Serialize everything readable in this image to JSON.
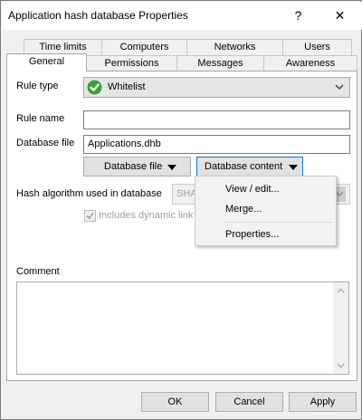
{
  "window": {
    "title": "Application hash database Properties",
    "help_glyph": "?",
    "close_glyph": "✕"
  },
  "tabs": {
    "row1": [
      "Time limits",
      "Computers",
      "Networks",
      "Users"
    ],
    "row2": [
      "General",
      "Permissions",
      "Messages",
      "Awareness"
    ],
    "active": "General"
  },
  "form": {
    "rule_type_label": "Rule type",
    "rule_type_value": "Whitelist",
    "rule_name_label": "Rule name",
    "rule_name_value": "",
    "database_file_label": "Database file",
    "database_file_value": "Applications.dhb",
    "database_file_button": "Database file",
    "database_content_button": "Database content",
    "hash_algorithm_label": "Hash algorithm used in database",
    "hash_algorithm_value": "SHA",
    "include_dll_label": "Includes dynamic link li",
    "include_dll_checked": true,
    "comment_label": "Comment",
    "comment_value": ""
  },
  "menu": {
    "items": [
      "View / edit...",
      "Merge...",
      "Properties..."
    ]
  },
  "buttons": {
    "ok": "OK",
    "cancel": "Cancel",
    "apply": "Apply"
  },
  "colors": {
    "accent": "#0078d7",
    "whitelist_icon": "#3aa335"
  }
}
